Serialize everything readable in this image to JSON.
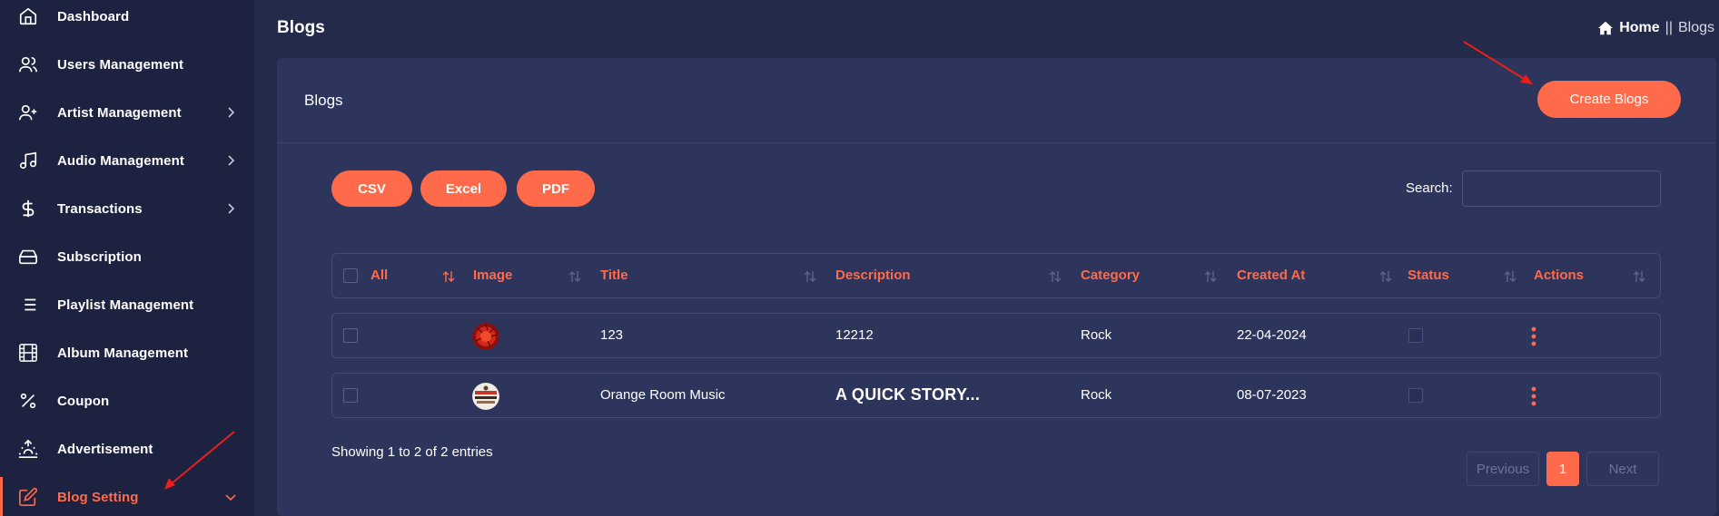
{
  "sidebar": {
    "items": [
      {
        "label": "Dashboard",
        "icon": "home-icon"
      },
      {
        "label": "Users Management",
        "icon": "users-icon"
      },
      {
        "label": "Artist Management",
        "icon": "user-plus-icon",
        "expandable": true
      },
      {
        "label": "Audio Management",
        "icon": "music-note-icon",
        "expandable": true
      },
      {
        "label": "Transactions",
        "icon": "dollar-icon",
        "expandable": true
      },
      {
        "label": "Subscription",
        "icon": "hard-drive-icon"
      },
      {
        "label": "Playlist Management",
        "icon": "list-icon"
      },
      {
        "label": "Album Management",
        "icon": "film-icon"
      },
      {
        "label": "Coupon",
        "icon": "percent-icon"
      },
      {
        "label": "Advertisement",
        "icon": "sunrise-icon"
      },
      {
        "label": "Blog Setting",
        "icon": "edit-icon",
        "expandable": true,
        "active": true
      }
    ]
  },
  "header": {
    "title": "Blogs",
    "breadcrumb": {
      "home": "Home",
      "separator": "||",
      "current": "Blogs"
    }
  },
  "card": {
    "title": "Blogs",
    "create_label": "Create Blogs"
  },
  "toolbar": {
    "csv": "CSV",
    "excel": "Excel",
    "pdf": "PDF",
    "search_label": "Search:",
    "search_value": ""
  },
  "table": {
    "columns": [
      "All",
      "Image",
      "Title",
      "Description",
      "Category",
      "Created At",
      "Status",
      "Actions"
    ],
    "rows": [
      {
        "title": "123",
        "description": "12212",
        "category": "Rock",
        "created_at": "22-04-2024"
      },
      {
        "title": "Orange Room Music",
        "description": "A QUICK STORY...",
        "category": "Rock",
        "created_at": "08-07-2023"
      }
    ]
  },
  "footer": {
    "showing": "Showing 1 to 2 of 2 entries",
    "previous": "Previous",
    "page": "1",
    "next": "Next"
  },
  "colors": {
    "accent": "#ff6b4a",
    "background": "#242a4a",
    "sidebar": "#1d2240",
    "card": "#2e355c"
  }
}
